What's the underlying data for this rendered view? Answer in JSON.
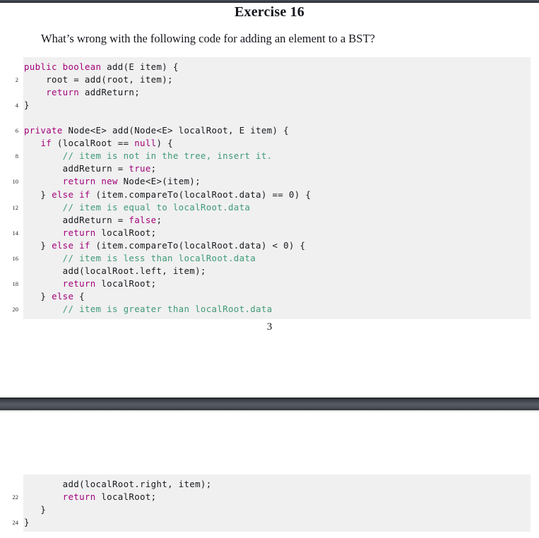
{
  "document": {
    "title": "Exercise 16",
    "question": "What’s wrong with the following code for adding an element to a BST?",
    "page_number": "3"
  },
  "colors": {
    "keyword": "#a3007a",
    "comment": "#3f9a77",
    "plain": "#16181d",
    "code_background": "#f0f0f0",
    "page_separator": "#383d44",
    "page_background": "#ffffff"
  },
  "code_block_one": {
    "language": "java",
    "lines": [
      {
        "number": "",
        "tokens": [
          {
            "t": "kw",
            "s": "public"
          },
          {
            "t": "pl",
            "s": " "
          },
          {
            "t": "kw",
            "s": "boolean"
          },
          {
            "t": "pl",
            "s": " add(E item) {"
          }
        ]
      },
      {
        "number": "2",
        "tokens": [
          {
            "t": "pl",
            "s": "    root = add(root, item);"
          }
        ]
      },
      {
        "number": "",
        "tokens": [
          {
            "t": "pl",
            "s": "    "
          },
          {
            "t": "kw",
            "s": "return"
          },
          {
            "t": "pl",
            "s": " addReturn;"
          }
        ]
      },
      {
        "number": "4",
        "tokens": [
          {
            "t": "pl",
            "s": "}"
          }
        ]
      },
      {
        "number": "",
        "tokens": [
          {
            "t": "pl",
            "s": ""
          }
        ]
      },
      {
        "number": "6",
        "tokens": [
          {
            "t": "kw",
            "s": "private"
          },
          {
            "t": "pl",
            "s": " Node<E> add(Node<E> localRoot, E item) {"
          }
        ]
      },
      {
        "number": "",
        "tokens": [
          {
            "t": "pl",
            "s": "   "
          },
          {
            "t": "kw",
            "s": "if"
          },
          {
            "t": "pl",
            "s": " (localRoot == "
          },
          {
            "t": "kw",
            "s": "null"
          },
          {
            "t": "pl",
            "s": ") {"
          }
        ]
      },
      {
        "number": "8",
        "tokens": [
          {
            "t": "pl",
            "s": "       "
          },
          {
            "t": "cm",
            "s": "// item is not in the tree, insert it."
          }
        ]
      },
      {
        "number": "",
        "tokens": [
          {
            "t": "pl",
            "s": "       addReturn = "
          },
          {
            "t": "kw",
            "s": "true"
          },
          {
            "t": "pl",
            "s": ";"
          }
        ]
      },
      {
        "number": "10",
        "tokens": [
          {
            "t": "pl",
            "s": "       "
          },
          {
            "t": "kw",
            "s": "return new"
          },
          {
            "t": "pl",
            "s": " Node<E>(item);"
          }
        ]
      },
      {
        "number": "",
        "tokens": [
          {
            "t": "pl",
            "s": "   } "
          },
          {
            "t": "kw",
            "s": "else if"
          },
          {
            "t": "pl",
            "s": " (item.compareTo(localRoot.data) == 0) {"
          }
        ]
      },
      {
        "number": "12",
        "tokens": [
          {
            "t": "pl",
            "s": "       "
          },
          {
            "t": "cm",
            "s": "// item is equal to localRoot.data"
          }
        ]
      },
      {
        "number": "",
        "tokens": [
          {
            "t": "pl",
            "s": "       addReturn = "
          },
          {
            "t": "kw",
            "s": "false"
          },
          {
            "t": "pl",
            "s": ";"
          }
        ]
      },
      {
        "number": "14",
        "tokens": [
          {
            "t": "pl",
            "s": "       "
          },
          {
            "t": "kw",
            "s": "return"
          },
          {
            "t": "pl",
            "s": " localRoot;"
          }
        ]
      },
      {
        "number": "",
        "tokens": [
          {
            "t": "pl",
            "s": "   } "
          },
          {
            "t": "kw",
            "s": "else if"
          },
          {
            "t": "pl",
            "s": " (item.compareTo(localRoot.data) < 0) {"
          }
        ]
      },
      {
        "number": "16",
        "tokens": [
          {
            "t": "pl",
            "s": "       "
          },
          {
            "t": "cm",
            "s": "// item is less than localRoot.data"
          }
        ]
      },
      {
        "number": "",
        "tokens": [
          {
            "t": "pl",
            "s": "       add(localRoot.left, item);"
          }
        ]
      },
      {
        "number": "18",
        "tokens": [
          {
            "t": "pl",
            "s": "       "
          },
          {
            "t": "kw",
            "s": "return"
          },
          {
            "t": "pl",
            "s": " localRoot;"
          }
        ]
      },
      {
        "number": "",
        "tokens": [
          {
            "t": "pl",
            "s": "   } "
          },
          {
            "t": "kw",
            "s": "else"
          },
          {
            "t": "pl",
            "s": " {"
          }
        ]
      },
      {
        "number": "20",
        "tokens": [
          {
            "t": "pl",
            "s": "       "
          },
          {
            "t": "cm",
            "s": "// item is greater than localRoot.data"
          }
        ]
      }
    ]
  },
  "code_block_two": {
    "language": "java",
    "lines": [
      {
        "number": "",
        "tokens": [
          {
            "t": "pl",
            "s": "       add(localRoot.right, item);"
          }
        ]
      },
      {
        "number": "22",
        "tokens": [
          {
            "t": "pl",
            "s": "       "
          },
          {
            "t": "kw",
            "s": "return"
          },
          {
            "t": "pl",
            "s": " localRoot;"
          }
        ]
      },
      {
        "number": "",
        "tokens": [
          {
            "t": "pl",
            "s": "   }"
          }
        ]
      },
      {
        "number": "24",
        "tokens": [
          {
            "t": "pl",
            "s": "}"
          }
        ]
      }
    ]
  }
}
